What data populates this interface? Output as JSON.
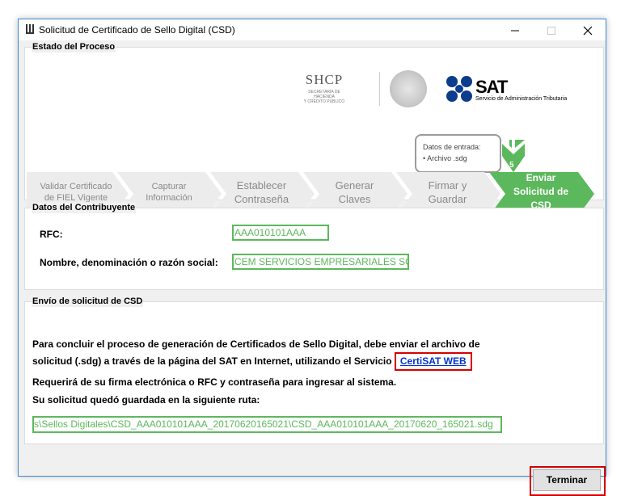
{
  "window": {
    "title": "Solicitud de Certificado de Sello Digital (CSD)",
    "minimize_icon": "minimize-icon",
    "maximize_icon": "maximize-icon",
    "close_icon": "close-icon"
  },
  "process": {
    "legend": "Estado del Proceso",
    "shcp": {
      "title": "SHCP",
      "subtitle_1": "SECRETARÍA DE HACIENDA",
      "subtitle_2": "Y CRÉDITO PÚBLICO"
    },
    "sat": {
      "title": "SAT",
      "subtitle": "Servicio de Administración Tributaria"
    },
    "input_box": {
      "line1": "Datos de entrada:",
      "line2": "• Archivo .sdg"
    },
    "current_step_number": "5",
    "steps": [
      {
        "line1": "Validar Certificado",
        "line2": "de FIEL Vigente",
        "line3": ""
      },
      {
        "line1": "Capturar",
        "line2": "Información",
        "line3": ""
      },
      {
        "line1": "Establecer",
        "line2": "Contraseña",
        "line3": ""
      },
      {
        "line1": "Generar",
        "line2": "Claves",
        "line3": ""
      },
      {
        "line1": "Firmar y",
        "line2": "Guardar",
        "line3": ""
      },
      {
        "line1": "Enviar",
        "line2": "Solicitud de",
        "line3": "CSD"
      }
    ],
    "colors": {
      "active_step": "#5cb85c",
      "inactive_step": "#ececec"
    }
  },
  "taxpayer": {
    "legend": "Datos del Contribuyente",
    "rfc_label": "RFC:",
    "rfc_value": "AAA010101AAA",
    "name_label": "Nombre, denominación o razón social:",
    "name_value": "CEM SERVICIOS EMPRESARIALES SC"
  },
  "send": {
    "legend": "Envío de solicitud de CSD",
    "para1_line1": "Para concluir el proceso de generación de Certificados de Sello Digital, debe enviar el archivo de",
    "para1_line2": "solicitud (.sdg) a través de la página del SAT en Internet, utilizando el Servicio",
    "link": "CertiSAT WEB",
    "para2": "Requerirá de su firma electrónica o RFC y contraseña para ingresar al sistema.",
    "para3": "Su solicitud quedó guardada en la siguiente ruta:",
    "path": "s\\Sellos Digitales\\CSD_AAA010101AAA_20170620165021\\CSD_AAA010101AAA_20170620_165021.sdg"
  },
  "footer": {
    "finish_button": "Terminar"
  }
}
